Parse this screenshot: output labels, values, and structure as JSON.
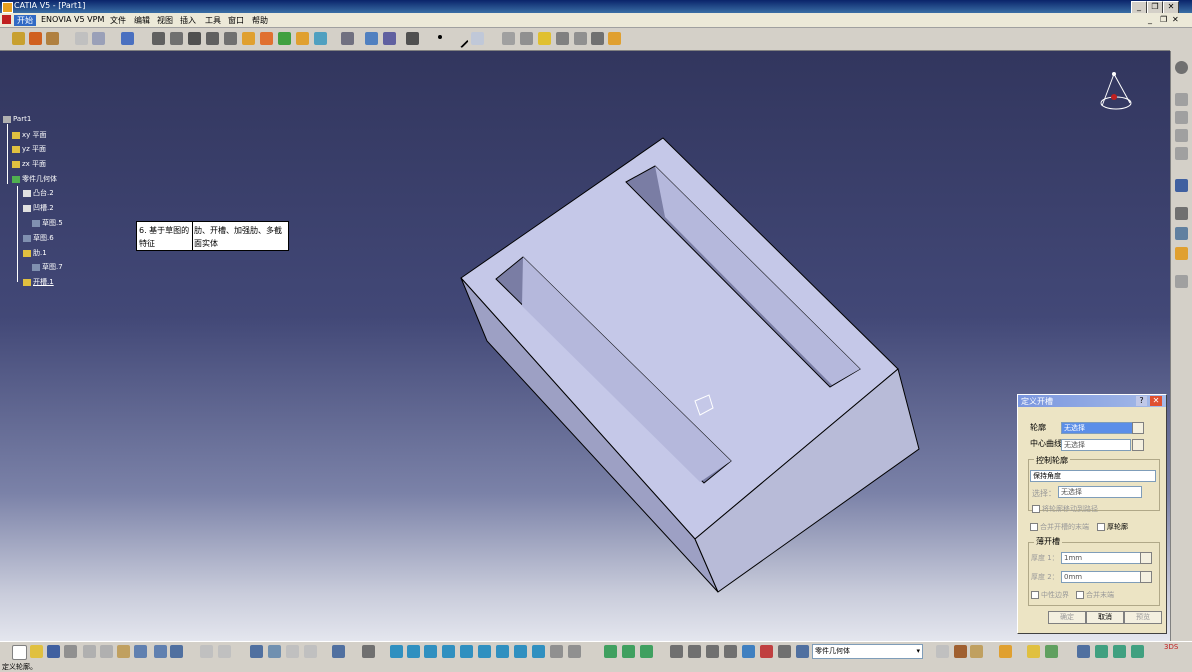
{
  "window": {
    "title": "CATIA V5 - [Part1]"
  },
  "menu": [
    "开始",
    "ENOVIA V5 VPM",
    "文件",
    "编辑",
    "视图",
    "插入",
    "工具",
    "窗口",
    "帮助"
  ],
  "tree": {
    "root": "Part1",
    "planes": [
      "xy 平面",
      "yz 平面",
      "zx 平面"
    ],
    "body": "零件几何体",
    "features": [
      "凸台.2",
      "凹槽.2",
      "草图.5",
      "草图.6",
      "肋.1",
      "草图.7",
      "开槽.1"
    ]
  },
  "tooltip": {
    "col1": "6. 基于草图的特征",
    "col2": "肋、开槽、加强肋、多截面实体"
  },
  "dialog": {
    "title": "定义开槽",
    "profile_label": "轮廓",
    "profile_value": "无选择",
    "center_label": "中心曲线",
    "center_value": "无选择",
    "control_group": "控制轮廓",
    "control_option": "保持角度",
    "select_label": "选择：",
    "select_value": "无选择",
    "move_profile": "将轮廓移动到路径",
    "merge_ends": "合并开槽的末端",
    "thick_profile": "厚轮廓",
    "thin_group": "薄开槽",
    "thickness1_label": "厚度 1：",
    "thickness1_value": "1mm",
    "thickness2_label": "厚度 2：",
    "thickness2_value": "0mm",
    "neutral_fiber": "中性边界",
    "merge_ends2": "合并末端",
    "ok": "确定",
    "cancel": "取消",
    "preview": "预览"
  },
  "bottom": {
    "body_select": "零件几何体"
  },
  "status": {
    "text": "定义轮廓。"
  }
}
